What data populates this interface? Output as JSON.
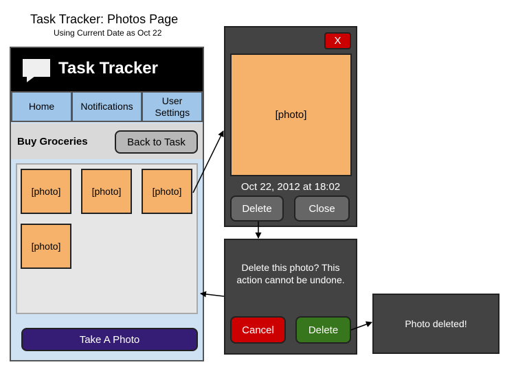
{
  "diagram": {
    "title": "Task Tracker: Photos Page",
    "subtitle": "Using Current Date as Oct 22"
  },
  "app": {
    "icon": "chat-bubble-icon",
    "title": "Task Tracker",
    "nav": {
      "home": "Home",
      "notifications": "Notifications",
      "user_settings": "User Settings"
    },
    "task_name": "Buy Groceries",
    "back_label": "Back to Task",
    "photos": [
      "[photo]",
      "[photo]",
      "[photo]",
      "[photo]"
    ],
    "take_photo_label": "Take A Photo"
  },
  "viewer": {
    "close_x": "X",
    "photo": "[photo]",
    "date": "Oct 22, 2012 at 18:02",
    "delete_label": "Delete",
    "close_label": "Close"
  },
  "confirm": {
    "message": "Delete this photo?  This action cannot be undone.",
    "cancel_label": "Cancel",
    "delete_label": "Delete"
  },
  "result": {
    "message": "Photo deleted!"
  },
  "colors": {
    "panel_bg": "#cfe2f3",
    "nav_bg": "#9fc5e8",
    "photo_fill": "#f6b26b",
    "dialog_bg": "#434343",
    "danger": "#cc0000",
    "confirm": "#38761d",
    "primary": "#351c75"
  }
}
